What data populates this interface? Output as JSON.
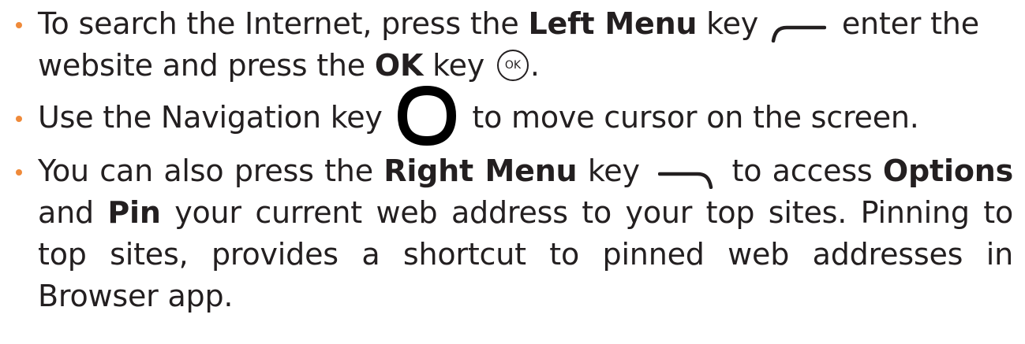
{
  "colors": {
    "bullet": "#ef8a3a",
    "text": "#231f20"
  },
  "items": [
    {
      "t1": "To search the Internet, press the ",
      "b1": "Left Menu",
      "t2": " key ",
      "icon": "left-menu-key-icon",
      "t3": " enter the website and press the ",
      "b2": "OK",
      "t4": " key ",
      "key_label": "OK",
      "t5": "."
    },
    {
      "t1": "Use the Navigation key ",
      "icon": "navigation-key-icon",
      "t2": " to move cursor on the screen."
    },
    {
      "t1": "You can also press the ",
      "b1": "Right Menu",
      "t2": " key ",
      "icon": "right-menu-key-icon",
      "t3": " to access ",
      "b2": "Options",
      "t4": " and ",
      "b3": "Pin",
      "t5": " your current web address to your top sites. Pinning to top sites, provides a shortcut to pinned web addresses in Browser app."
    }
  ]
}
